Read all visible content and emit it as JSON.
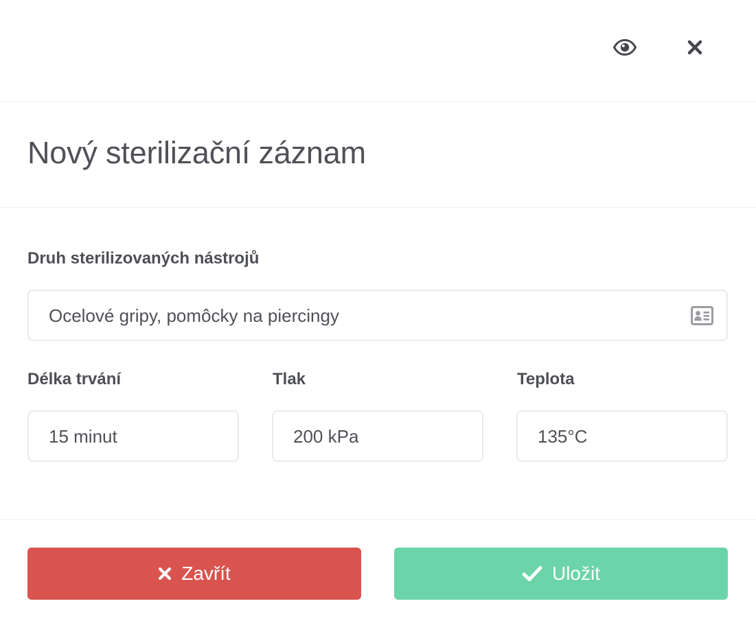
{
  "header": {
    "preview_icon": "eye-icon",
    "close_icon": "close-icon"
  },
  "title": "Nový sterilizační záznam",
  "form": {
    "instruments": {
      "label": "Druh sterilizovaných nástrojů",
      "value": "Ocelové gripy, pomôcky na piercingy",
      "icon": "id-card-icon"
    },
    "duration": {
      "label": "Délka trvání",
      "value": "15 minut"
    },
    "pressure": {
      "label": "Tlak",
      "value": "200 kPa"
    },
    "temperature": {
      "label": "Teplota",
      "value": "135°C"
    }
  },
  "actions": {
    "close_label": "Zavřít",
    "close_icon": "x-icon",
    "close_color": "#d9534f",
    "save_label": "Uložit",
    "save_icon": "check-icon",
    "save_color": "#6bd4a8"
  }
}
